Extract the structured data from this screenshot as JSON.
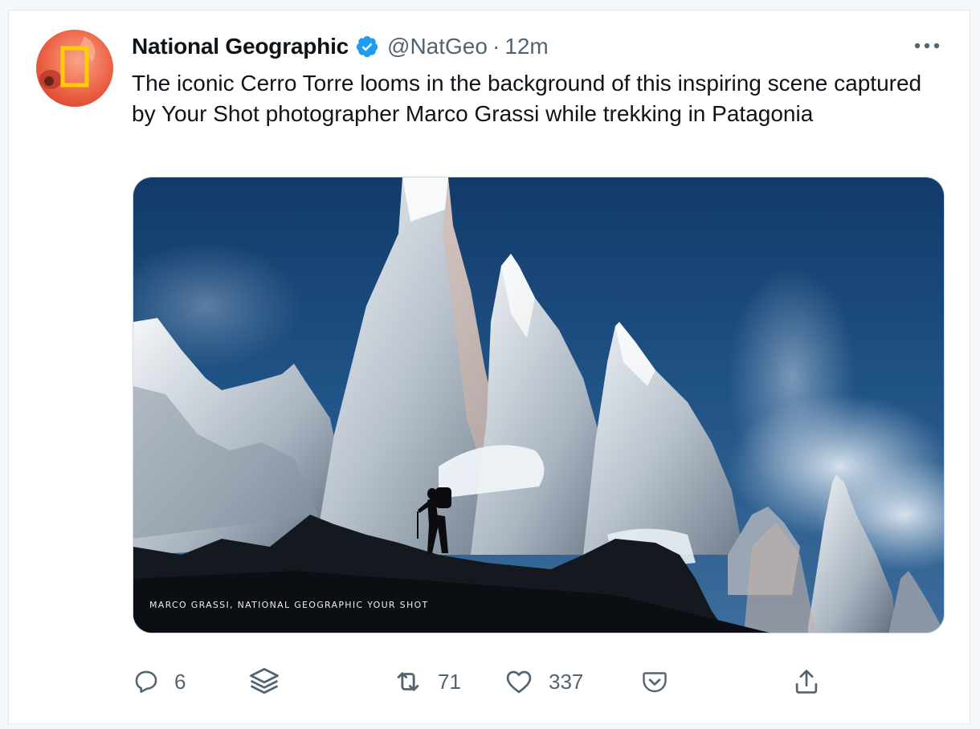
{
  "tweet": {
    "author_name": "National Geographic",
    "handle": "@NatGeo",
    "separator": "·",
    "time": "12m",
    "verified": true,
    "text": "The iconic Cerro Torre looms in the background of this inspiring scene captured by Your Shot photographer Marco Grassi while trekking in Patagonia",
    "media": {
      "credit": "MARCO GRASSI, NATIONAL GEOGRAPHIC YOUR SHOT"
    }
  },
  "actions": {
    "reply": {
      "icon": "reply-icon",
      "count": "6"
    },
    "layers": {
      "icon": "layers-icon"
    },
    "retweet": {
      "icon": "retweet-icon",
      "count": "71"
    },
    "like": {
      "icon": "heart-icon",
      "count": "337"
    },
    "pocket": {
      "icon": "pocket-icon"
    },
    "share": {
      "icon": "share-icon"
    }
  },
  "colors": {
    "text": "#0f1419",
    "muted": "#536471",
    "verified": "#1d9bf0",
    "brand_yellow": "#ffce00"
  }
}
